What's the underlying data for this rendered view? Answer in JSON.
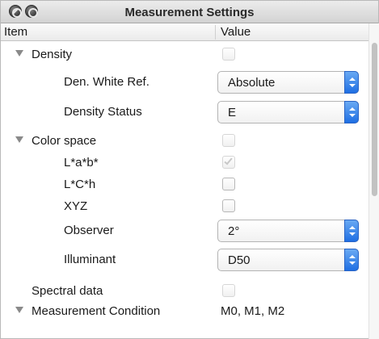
{
  "window": {
    "title": "Measurement Settings"
  },
  "columns": {
    "item": "Item",
    "value": "Value"
  },
  "rows": {
    "density": {
      "label": "Density",
      "checked": false
    },
    "den_white_ref": {
      "label": "Den. White Ref.",
      "value": "Absolute"
    },
    "density_status": {
      "label": "Density Status",
      "value": "E"
    },
    "color_space": {
      "label": "Color space",
      "checked": false
    },
    "lab": {
      "label": "L*a*b*",
      "checked": true
    },
    "lch": {
      "label": "L*C*h",
      "checked": false
    },
    "xyz": {
      "label": "XYZ",
      "checked": false
    },
    "observer": {
      "label": "Observer",
      "value": "2°"
    },
    "illuminant": {
      "label": "Illuminant",
      "value": "D50"
    },
    "spectral_data": {
      "label": "Spectral data",
      "checked": false
    },
    "measurement_condition": {
      "label": "Measurement Condition",
      "value": "M0, M1, M2"
    }
  },
  "colors": {
    "accent": "#1f6fe3",
    "disclosure": "#8a8a8a"
  }
}
